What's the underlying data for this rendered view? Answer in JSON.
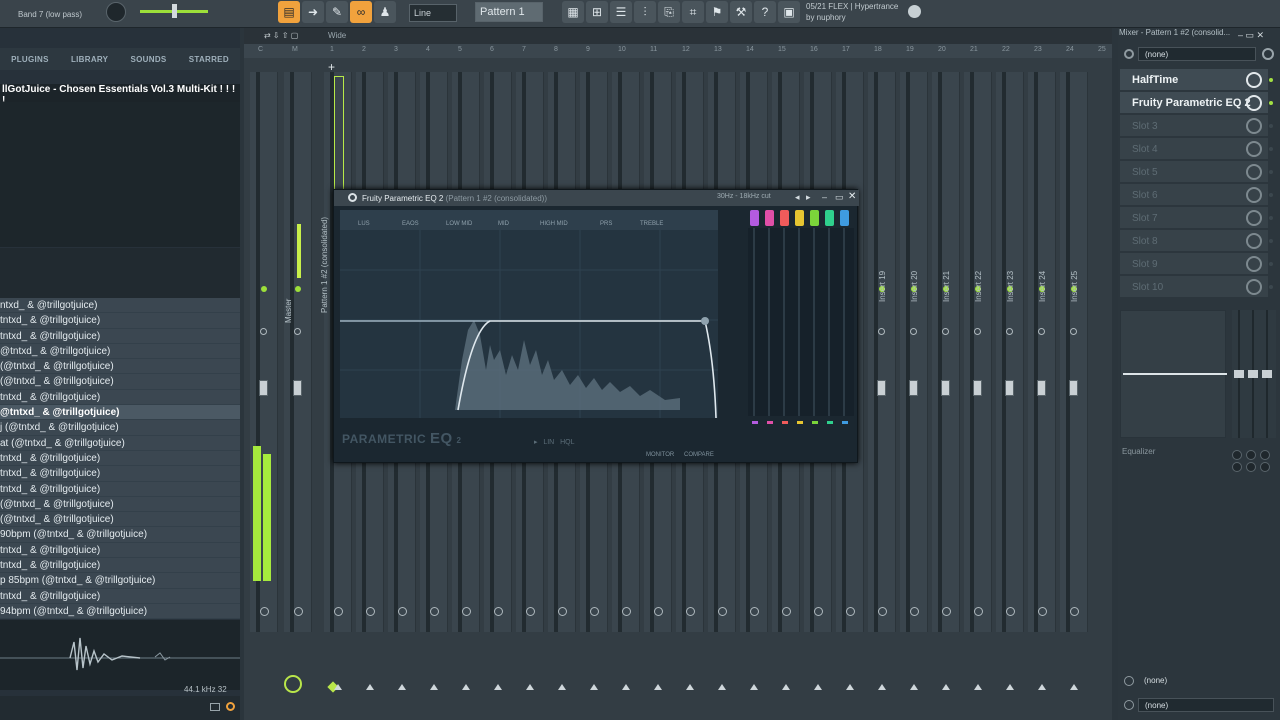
{
  "topbar": {
    "hint": "Band 7 (low pass)",
    "mode_select": "Line",
    "pattern_select": "Pattern 1",
    "song_position": "05/21",
    "song_title": "FLEX | Hypertrance",
    "song_author": "by nuphory",
    "buttons": [
      "tempo-icon",
      "play-icon",
      "pencil-icon",
      "paint-icon",
      "link-icon",
      "stamp-icon",
      "slice-icon",
      "piano-icon",
      "mixer-icon",
      "channel-rack-icon",
      "playlist-icon",
      "browser-icon",
      "plugin-icon",
      "download-icon",
      "gear-icon",
      "wrench-icon",
      "help-icon",
      "recording-icon"
    ]
  },
  "browser": {
    "tabs": [
      "PLUGINS",
      "LIBRARY",
      "SOUNDS",
      "STARRED"
    ],
    "folder": "llGotJuice - Chosen Essentials Vol.3 Multi-Kit ! ! ! !",
    "items": [
      "ntxd_ & @trillgotjuice)",
      "tntxd_ & @trillgotjuice)",
      "tntxd_ & @trillgotjuice)",
      "@tntxd_ & @trillgotjuice)",
      "(@tntxd_ & @trillgotjuice)",
      "(@tntxd_ & @trillgotjuice)",
      "tntxd_ & @trillgotjuice)",
      "@tntxd_ & @trillgotjuice)",
      "j (@tntxd_ & @trillgotjuice)",
      "at (@tntxd_ & @trillgotjuice)",
      "tntxd_ & @trillgotjuice)",
      "tntxd_ & @trillgotjuice)",
      "tntxd_ & @trillgotjuice)",
      "(@tntxd_ & @trillgotjuice)",
      "(@tntxd_ & @trillgotjuice)",
      "90bpm (@tntxd_ & @trillgotjuice)",
      "tntxd_ & @trillgotjuice)",
      "tntxd_ & @trillgotjuice)",
      "p 85bpm (@tntxd_ & @trillgotjuice)",
      "tntxd_ & @trillgotjuice)",
      "94bpm (@tntxd_ & @trillgotjuice)"
    ],
    "selected_index": 7,
    "sample_info": "44.1 kHz 32"
  },
  "mixer": {
    "zoom_label": "Wide",
    "ruler": [
      "C",
      "M",
      "1",
      "2",
      "3",
      "4",
      "5",
      "6",
      "7",
      "8",
      "9",
      "10",
      "11",
      "12",
      "13",
      "14",
      "15",
      "16",
      "17",
      "18",
      "19",
      "20",
      "21",
      "22",
      "23",
      "24",
      "25"
    ],
    "master_label": "Master",
    "track1_label": "Pattern 1 #2 (consolidated)",
    "insert_labels": [
      "Insert 18",
      "Insert 19",
      "Insert 20",
      "Insert 21",
      "Insert 22",
      "Insert 23",
      "Insert 24",
      "Insert 25"
    ]
  },
  "eq_window": {
    "title": "Fruity Parametric EQ 2",
    "subtitle": "(Pattern 1 #2 (consolidated))",
    "cut_label": "30Hz - 18kHz cut",
    "logo_a": "PARAMETRIC",
    "logo_b": "EQ",
    "logo_c": "2",
    "band_types": [
      "LUS",
      "EAOS",
      "LOW MID",
      "MID",
      "HIGH MID",
      "PRS",
      "TREBLE"
    ],
    "compare": "COMPARE",
    "monitor": "MONITOR",
    "band_colors": [
      "#b45be0",
      "#e04fa7",
      "#f05b5b",
      "#e6c531",
      "#7bd43a",
      "#2fd08d",
      "#3f9be0"
    ]
  },
  "fx_panel": {
    "title": "Mixer - Pattern 1 #2 (consolid...",
    "preset": "(none)",
    "slots": [
      "HalfTime",
      "Fruity Parametric EQ 2",
      "Slot 3",
      "Slot 4",
      "Slot 5",
      "Slot 6",
      "Slot 7",
      "Slot 8",
      "Slot 9",
      "Slot 10"
    ],
    "eq_label": "Equalizer",
    "route_in": "(none)",
    "route_out": "(none)"
  }
}
